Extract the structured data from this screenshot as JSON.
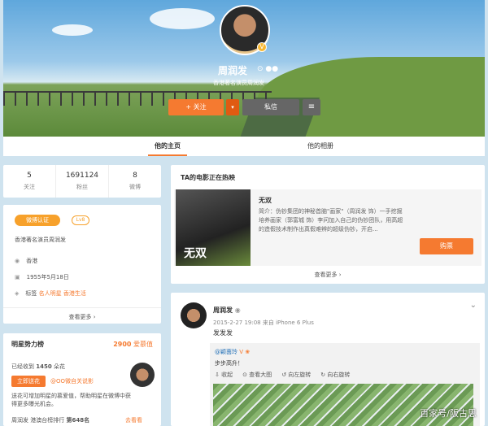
{
  "profile": {
    "name": "周润发",
    "name_icons": "⊙ ●●",
    "description": "香港著名演员周润发",
    "follow_label": "+ 关注",
    "message_label": "私信",
    "menu_label": "≡",
    "dropdown_label": "▾"
  },
  "tabs": [
    {
      "label": "他的主页",
      "active": true
    },
    {
      "label": "他的相册",
      "active": false
    }
  ],
  "stats": [
    {
      "value": "5",
      "label": "关注"
    },
    {
      "value": "1691124",
      "label": "粉丝"
    },
    {
      "value": "8",
      "label": "微博"
    }
  ],
  "info": {
    "verified": "微博认证",
    "level": "Lv8",
    "bio": "香港著名演员周润发",
    "location": "香港",
    "birthday": "1955年5月18日",
    "tags_label": "标签",
    "tags": "名人明星 香港生活",
    "more": "查看更多 ›"
  },
  "power": {
    "title": "明星势力榜",
    "score": "2900",
    "score_unit": "爱慕值",
    "received_prefix": "已经收到",
    "received_count": "1450",
    "received_unit": "朵花",
    "send_button": "立即送花",
    "send_link": "@OO微自关说影",
    "desc": "送花可增加明星的慕爱值，帮助明星在微博中获得更多曝光机会。",
    "rank_prefix": "周润发 港澳台榜排行",
    "rank": "第648名",
    "rank_link": "去看看"
  },
  "movie": {
    "section_title": "TA的电影正在热映",
    "poster_text": "无双",
    "name": "无双",
    "desc": "简介：伪钞集团的神秘首脑\"画家\"（周润发 饰）一手挖掘培养画家（郭富城 饰）李问加入自己的伪钞团队，用高超的造假技术制作出真假难辨的超级伪钞，开启...",
    "buy_label": "购票",
    "more": "查看更多 ›"
  },
  "post": {
    "author": "周润发",
    "author_badge": "◉",
    "time": "2015-2-27 19:08 来自 iPhone 6 Plus",
    "text": "发发发",
    "chevron": "⌄",
    "retweet": {
      "author": "@颖茵玲",
      "author_badge": "V ❀",
      "text": "步步高升！",
      "actions": [
        "⇩ 收起",
        "⊙ 查看大图",
        "↺ 向左旋转",
        "↻ 向右旋转"
      ]
    }
  },
  "watermark": "百家号/阪古思"
}
